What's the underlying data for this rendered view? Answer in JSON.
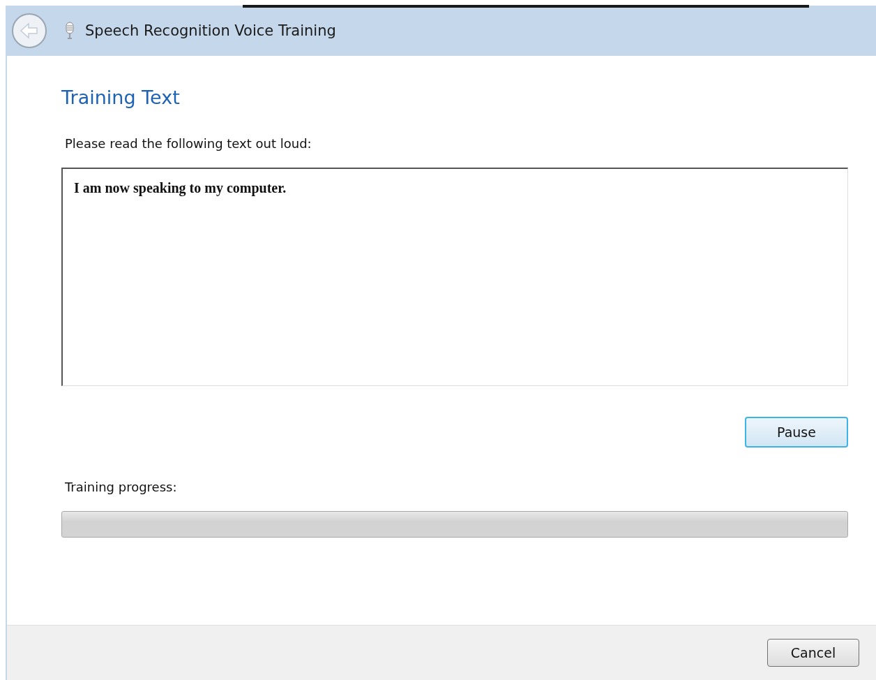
{
  "window": {
    "title": "Speech Recognition Voice Training"
  },
  "heading": "Training Text",
  "instruction": "Please read the following text out loud:",
  "training_text": "I am now speaking to my computer.",
  "pause_button": {
    "label": "Pause",
    "focused": true
  },
  "progress": {
    "label": "Training progress:",
    "level": 0
  },
  "buttons": [
    "Cancel"
  ]
}
